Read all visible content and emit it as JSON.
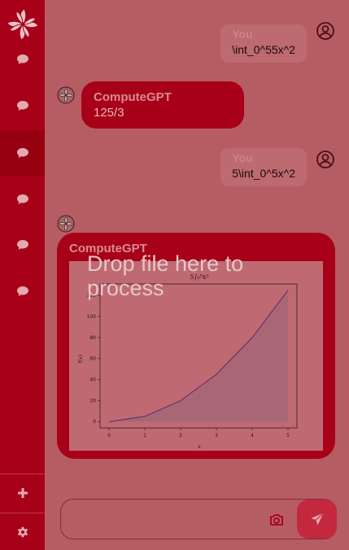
{
  "sidebar": {
    "logo": "pinwheel-logo",
    "items": [
      {
        "icon": "chat-bubble-icon",
        "active": false
      },
      {
        "icon": "chat-bubble-icon",
        "active": false
      },
      {
        "icon": "chat-bubble-icon",
        "active": true
      },
      {
        "icon": "chat-bubble-icon",
        "active": false
      },
      {
        "icon": "chat-bubble-icon",
        "active": false
      },
      {
        "icon": "chat-bubble-icon",
        "active": false
      }
    ],
    "new_chat_icon": "plus-icon",
    "settings_icon": "gear-icon"
  },
  "messages": [
    {
      "role": "user",
      "author": "You",
      "text": "\\int_0^55x^2"
    },
    {
      "role": "bot",
      "author": "ComputeGPT",
      "text": "125/3"
    },
    {
      "role": "user",
      "author": "You",
      "text": "5\\int_0^5x^2"
    },
    {
      "role": "bot",
      "author": "ComputeGPT",
      "text": ""
    }
  ],
  "overlay": {
    "drop_text": "Drop file here to process"
  },
  "chart_data": {
    "type": "area",
    "title": "5∫₀⁵x²",
    "xlabel": "x",
    "ylabel": "f(x)",
    "x": [
      0,
      1,
      2,
      3,
      4,
      5
    ],
    "y": [
      0,
      5,
      20,
      45,
      80,
      125
    ],
    "xticks": [
      0,
      1,
      2,
      3,
      4,
      5
    ],
    "yticks": [
      0,
      20,
      40,
      60,
      80,
      100,
      120
    ],
    "xlim": [
      -0.25,
      5.25
    ],
    "ylim": [
      -6,
      131
    ],
    "line_color": "#5a2b6b",
    "fill_color": "#a66674"
  },
  "composer": {
    "value": "",
    "camera_icon": "camera-icon",
    "send_icon": "send-icon"
  },
  "colors": {
    "sidebar": "#a80018",
    "background": "#b65d64",
    "accent": "#c4283f"
  }
}
